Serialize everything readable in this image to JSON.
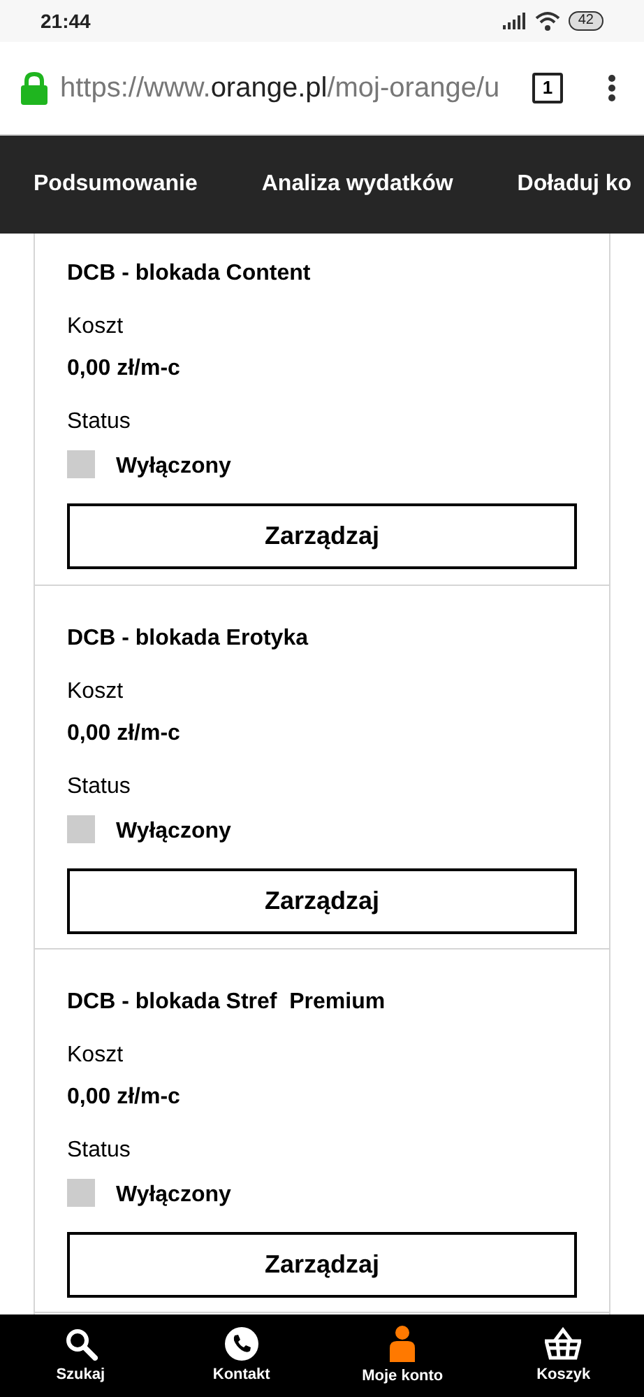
{
  "status_bar": {
    "time": "21:44",
    "battery": "42"
  },
  "browser": {
    "url": {
      "prefix": "https://www.",
      "host": "orange.pl",
      "path": "/moj-orange/u"
    },
    "tab_count": "1"
  },
  "nav_tabs": [
    {
      "label": "Podsumowanie"
    },
    {
      "label": "Analiza wydatków"
    },
    {
      "label": "Doładuj ko"
    }
  ],
  "services": [
    {
      "title": "DCB - blokada Content",
      "cost_label": "Koszt",
      "cost": "0,00 zł/m-c",
      "status_label": "Status",
      "status": "Wyłączony",
      "checked": false,
      "button": "Zarządzaj"
    },
    {
      "title": "DCB - blokada Erotyka",
      "cost_label": "Koszt",
      "cost": "0,00 zł/m-c",
      "status_label": "Status",
      "status": "Wyłączony",
      "checked": false,
      "button": "Zarządzaj"
    },
    {
      "title": "DCB - blokada Stref  Premium",
      "cost_label": "Koszt",
      "cost": "0,00 zł/m-c",
      "status_label": "Status",
      "status": "Wyłączony",
      "checked": false,
      "button": "Zarządzaj"
    }
  ],
  "bottom_nav": [
    {
      "kind": "search",
      "label": "Szukaj",
      "selected": false
    },
    {
      "kind": "phone",
      "label": "Kontakt",
      "selected": false
    },
    {
      "kind": "account",
      "label": "Moje konto",
      "selected": true
    },
    {
      "kind": "basket",
      "label": "Koszyk",
      "selected": false
    }
  ]
}
